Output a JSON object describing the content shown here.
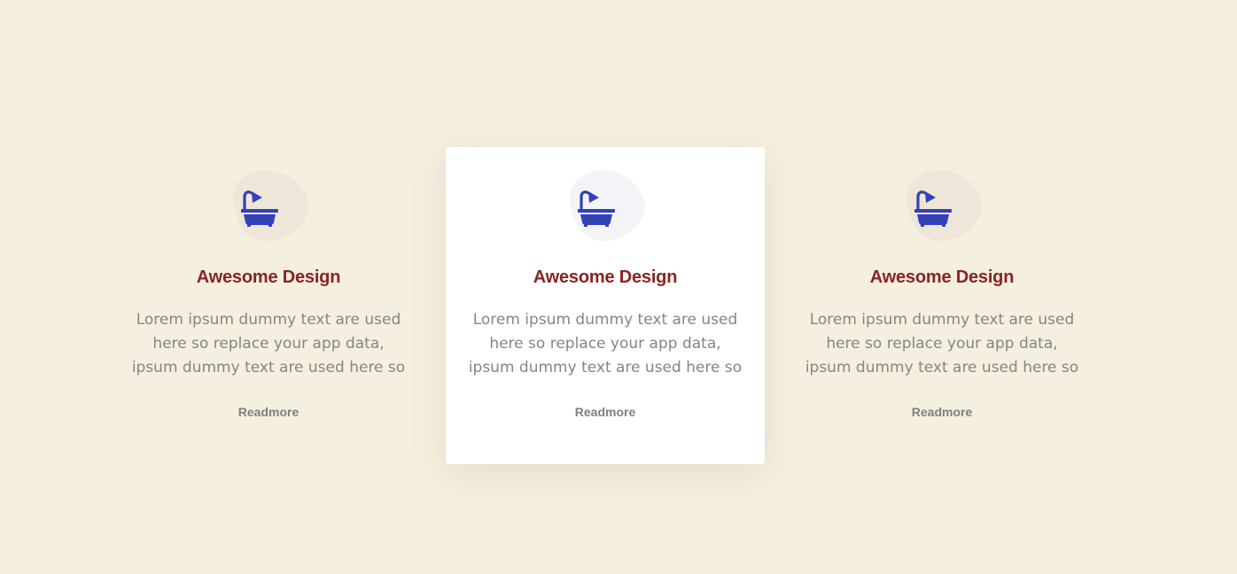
{
  "colors": {
    "background": "#f5efdf",
    "card_active": "#ffffff",
    "title": "#8a2323",
    "text": "#858585",
    "icon": "#3241b8",
    "blob_default": "#efe6da",
    "blob_active": "#f4f3f7"
  },
  "features": [
    {
      "icon": "bathtub-icon",
      "title": "Awesome Design",
      "description": "Lorem ipsum dummy text are used here so replace your app data, ipsum dummy text are used here so",
      "link_label": "Readmore",
      "active": false
    },
    {
      "icon": "bathtub-icon",
      "title": "Awesome Design",
      "description": "Lorem ipsum dummy text are used here so replace your app data, ipsum dummy text are used here so",
      "link_label": "Readmore",
      "active": true
    },
    {
      "icon": "bathtub-icon",
      "title": "Awesome Design",
      "description": "Lorem ipsum dummy text are used here so replace your app data, ipsum dummy text are used here so",
      "link_label": "Readmore",
      "active": false
    }
  ]
}
